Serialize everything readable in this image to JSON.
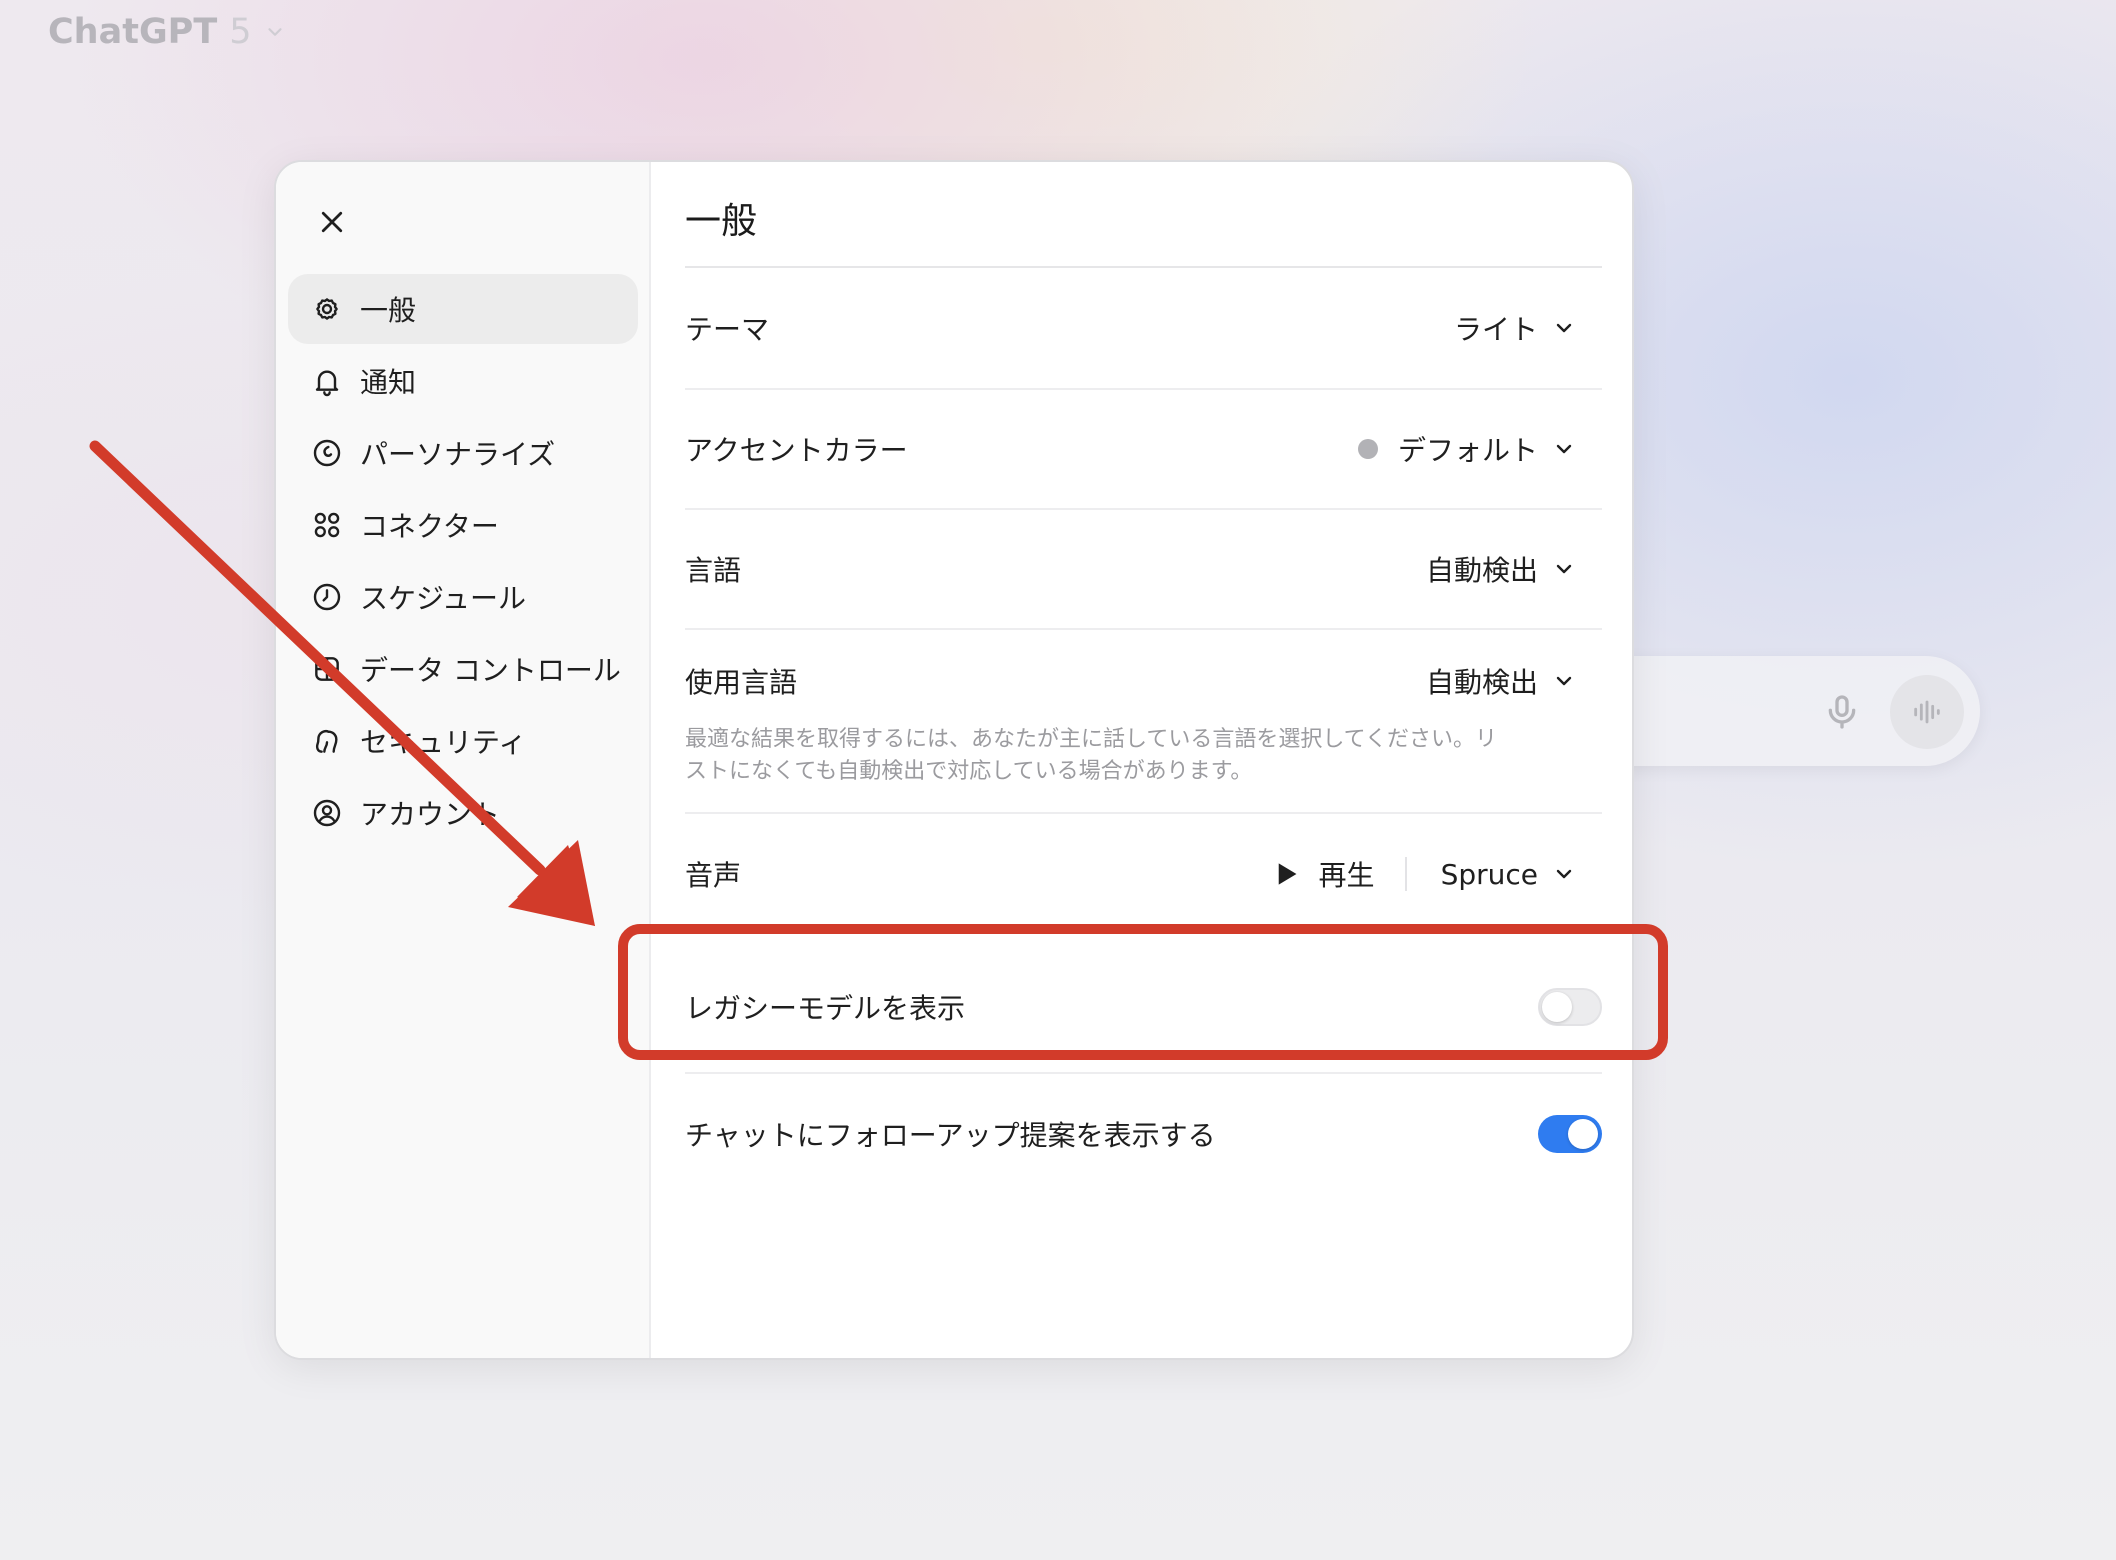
{
  "app": {
    "title": "ChatGPT",
    "version": "5"
  },
  "colors": {
    "accent_annotation": "#d23b2a",
    "toggle_on": "#2f7cf0",
    "toggle_off": "#ececee"
  },
  "sidebar": {
    "close_icon": "close-icon",
    "items": [
      {
        "label": "一般",
        "icon": "gear-icon",
        "active": true
      },
      {
        "label": "通知",
        "icon": "bell-icon",
        "active": false
      },
      {
        "label": "パーソナライズ",
        "icon": "personalize-icon",
        "active": false
      },
      {
        "label": "コネクター",
        "icon": "connectors-icon",
        "active": false
      },
      {
        "label": "スケジュール",
        "icon": "clock-icon",
        "active": false
      },
      {
        "label": "データ コントロール",
        "icon": "data-icon",
        "active": false
      },
      {
        "label": "セキュリティ",
        "icon": "security-icon",
        "active": false
      },
      {
        "label": "アカウント",
        "icon": "account-icon",
        "active": false
      }
    ]
  },
  "general": {
    "title": "一般",
    "theme": {
      "label": "テーマ",
      "value": "ライト"
    },
    "accent": {
      "label": "アクセントカラー",
      "value": "デフォルト",
      "dot_color": "#b2b2b6"
    },
    "language": {
      "label": "言語",
      "value": "自動検出"
    },
    "spoken_language": {
      "label": "使用言語",
      "value": "自動検出",
      "helper": "最適な結果を取得するには、あなたが主に話している言語を選択してください。リストになくても自動検出で対応している場合があります。"
    },
    "voice": {
      "label": "音声",
      "play_label": "再生",
      "value": "Spruce"
    },
    "legacy_models": {
      "label": "レガシーモデルを表示",
      "enabled": false
    },
    "follow_up": {
      "label": "チャットにフォローアップ提案を表示する",
      "enabled": true
    }
  }
}
